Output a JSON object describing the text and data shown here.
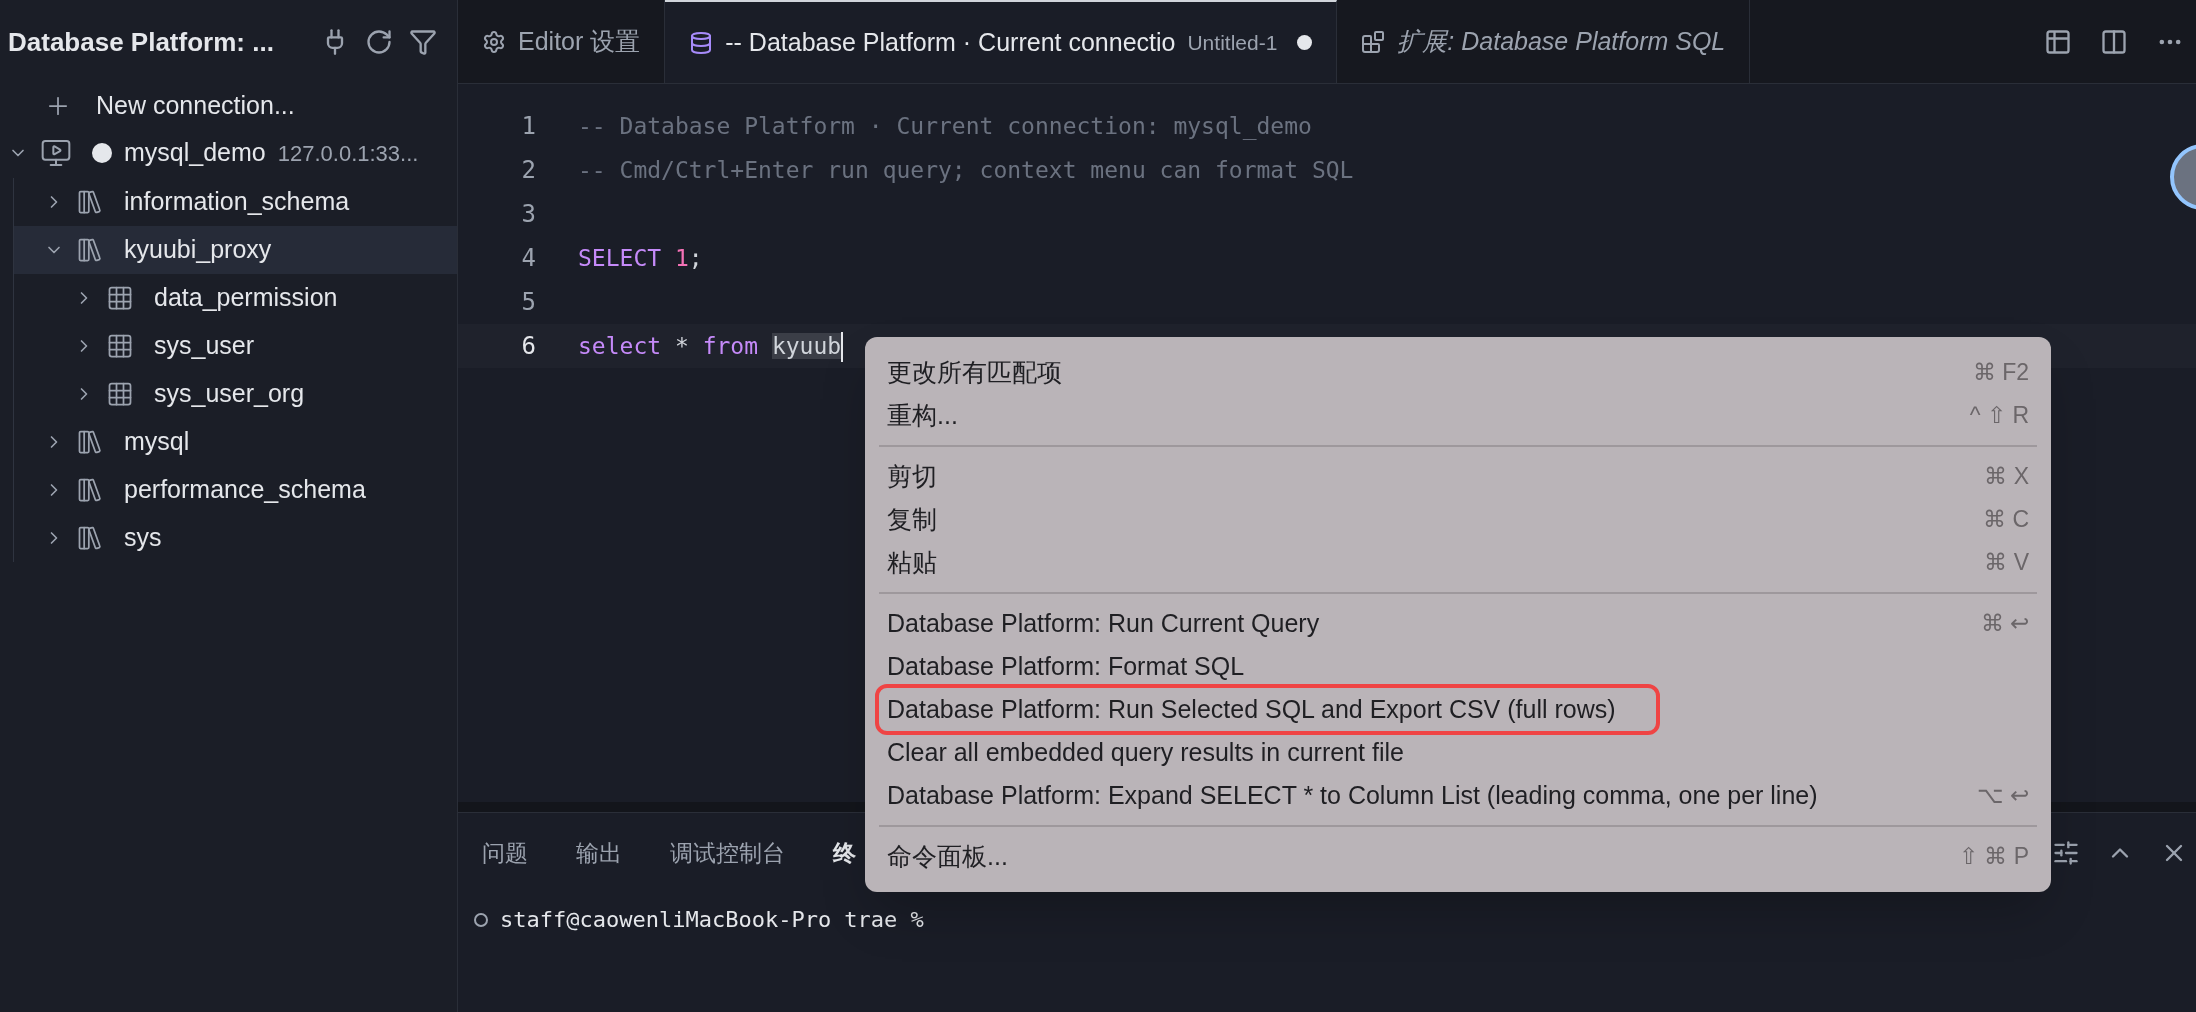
{
  "sidebar": {
    "title": "Database Platform: ...",
    "new_connection": "New connection...",
    "connections": [
      {
        "name": "mysql_demo",
        "host": "127.0.0.1:33...",
        "expanded": true,
        "connected": true,
        "children": [
          {
            "name": "information_schema",
            "kind": "schema",
            "expanded": false,
            "selected": false
          },
          {
            "name": "kyuubi_proxy",
            "kind": "schema",
            "expanded": true,
            "selected": true,
            "children": [
              {
                "name": "data_permission",
                "kind": "table",
                "expanded": false,
                "selected": false
              },
              {
                "name": "sys_user",
                "kind": "table",
                "expanded": false,
                "selected": false
              },
              {
                "name": "sys_user_org",
                "kind": "table",
                "expanded": false,
                "selected": false
              }
            ]
          },
          {
            "name": "mysql",
            "kind": "schema",
            "expanded": false,
            "selected": false
          },
          {
            "name": "performance_schema",
            "kind": "schema",
            "expanded": false,
            "selected": false
          },
          {
            "name": "sys",
            "kind": "schema",
            "expanded": false,
            "selected": false
          }
        ]
      }
    ]
  },
  "tabs": [
    {
      "kind": "settings",
      "label": "Editor 设置",
      "selected": false
    },
    {
      "kind": "file",
      "label": "-- Database Platform · Current connectio",
      "description": "Untitled-1",
      "modified": true,
      "selected": true
    },
    {
      "kind": "extension",
      "label": "扩展: Database Platform SQL",
      "selected": false
    }
  ],
  "editor": {
    "lines": [
      {
        "number": "1",
        "current": false,
        "tokens": [
          {
            "kind": "comment",
            "text": "-- Database Platform · Current connection: mysql_demo"
          }
        ]
      },
      {
        "number": "2",
        "current": false,
        "tokens": [
          {
            "kind": "comment",
            "text": "-- Cmd/Ctrl+Enter run query; context menu can format SQL"
          }
        ]
      },
      {
        "number": "3",
        "current": false
      },
      {
        "number": "4",
        "current": false,
        "tokens": [
          {
            "kind": "keyword",
            "text": "SELECT "
          },
          {
            "kind": "number",
            "text": "1"
          },
          {
            "kind": "plain",
            "text": ";"
          }
        ]
      },
      {
        "number": "5",
        "current": false
      },
      {
        "number": "6",
        "current": true,
        "tokens": [
          {
            "kind": "keyword",
            "text": "select"
          },
          {
            "kind": "plain",
            "text": " * "
          },
          {
            "kind": "keyword",
            "text": "from "
          },
          {
            "kind": "selection",
            "text": "kyuub"
          }
        ]
      }
    ]
  },
  "context_menu": {
    "groups": [
      [
        {
          "label": "更改所有匹配项",
          "shortcut": "⌘ F2",
          "highlighted": false
        },
        {
          "label": "重构...",
          "shortcut": "^ ⇧ R",
          "highlighted": false
        }
      ],
      [
        {
          "label": "剪切",
          "shortcut": "⌘ X",
          "highlighted": false
        },
        {
          "label": "复制",
          "shortcut": "⌘ C",
          "highlighted": false
        },
        {
          "label": "粘贴",
          "shortcut": "⌘ V",
          "highlighted": false
        }
      ],
      [
        {
          "label": "Database Platform: Run Current Query",
          "shortcut": "⌘ ↩",
          "highlighted": false
        },
        {
          "label": "Database Platform: Format SQL",
          "highlighted": false
        },
        {
          "label": "Database Platform: Run Selected SQL and Export CSV (full rows)",
          "highlighted": true
        },
        {
          "label": "Clear all embedded query results in current file",
          "highlighted": false
        },
        {
          "label": "Database Platform: Expand SELECT * to Column List (leading comma, one per line)",
          "shortcut": "⌥ ↩",
          "highlighted": false
        }
      ],
      [
        {
          "label": "命令面板...",
          "shortcut": "⇧ ⌘ P",
          "highlighted": false
        }
      ]
    ]
  },
  "panel": {
    "tabs": [
      {
        "label": "问题",
        "selected": false
      },
      {
        "label": "输出",
        "selected": false
      },
      {
        "label": "调试控制台",
        "selected": false
      },
      {
        "label": "终",
        "selected": true
      }
    ],
    "terminal": {
      "prompt": "staff@caowenliMacBook-Pro trae %"
    }
  }
}
